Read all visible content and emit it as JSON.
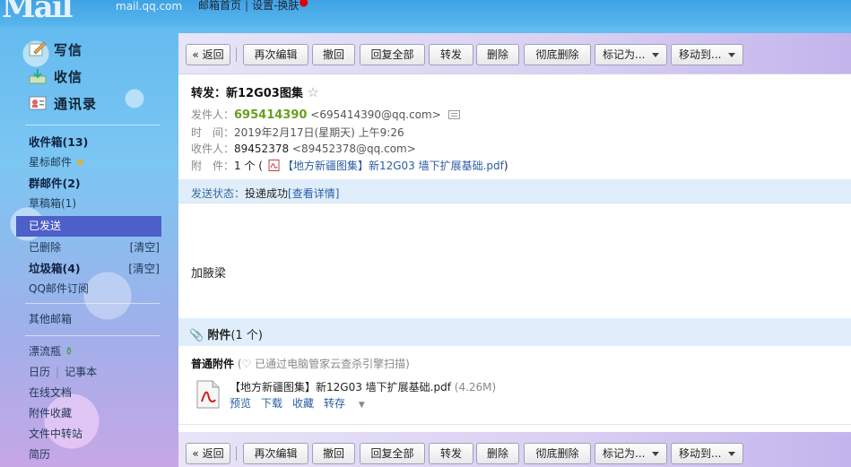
{
  "app": {
    "logo_text": "Mail",
    "logo_domain": "mail.qq.com"
  },
  "topnav": {
    "home": "邮箱首页",
    "sep": "|",
    "settings": "设置",
    "dash": "-",
    "skin": "换肤"
  },
  "sidebar": {
    "actions": [
      {
        "label": "写信",
        "icon": "write-icon"
      },
      {
        "label": "收信",
        "icon": "inbox-download-icon"
      },
      {
        "label": "通讯录",
        "icon": "contacts-icon"
      }
    ],
    "folders": [
      {
        "label": "收件箱(13)",
        "bold": true
      },
      {
        "label": "星标邮件",
        "icon": "star-icon"
      },
      {
        "label": "群邮件(2)",
        "bold": true
      },
      {
        "label": "草稿箱(1)"
      },
      {
        "label": "已发送",
        "active": true
      },
      {
        "label": "已删除",
        "action": "[清空]"
      },
      {
        "label": "垃圾箱(4)",
        "bold": true,
        "action": "[清空]"
      },
      {
        "label": "QQ邮件订阅"
      }
    ],
    "other": "其他邮箱",
    "apps": [
      {
        "label": "漂流瓶",
        "icon": "bottle-icon"
      },
      {
        "label": "日历",
        "extra": "记事本"
      },
      {
        "label": "在线文档"
      },
      {
        "label": "附件收藏"
      },
      {
        "label": "文件中转站"
      },
      {
        "label": "简历"
      }
    ]
  },
  "toolbar": {
    "back": "« 返回",
    "edit_again": "再次编辑",
    "recall": "撤回",
    "reply_all": "回复全部",
    "forward": "转发",
    "delete": "删除",
    "delete_perm": "彻底删除",
    "mark_as": "标记为...",
    "move_to": "移动到..."
  },
  "email": {
    "subject": "转发：新12G03图集",
    "from_label": "发件人：",
    "from_name": "695414390",
    "from_addr": "<695414390@qq.com>",
    "time_label": "时　间：",
    "time": "2019年2月17日(星期天) 上午9:26",
    "to_label": "收件人：",
    "to_name": "89452378",
    "to_addr": "<89452378@qq.com>",
    "att_label": "附　件：",
    "att_count": "1 个 (",
    "att_file": "【地方新疆图集】新12G03 墙下扩展基础.pdf",
    "att_close": ")",
    "status_label": "发送状态：",
    "status_value": "投递成功",
    "status_link": "[查看详情]",
    "body": "加腋梁"
  },
  "attachments": {
    "heading": "附件",
    "count": "(1 个)",
    "type_label": "普通附件",
    "scan_note": "(♡ 已通过电脑管家云查杀引擎扫描)",
    "file_name": "【地方新疆图集】新12G03 墙下扩展基础.pdf",
    "file_size": "(4.26M)",
    "actions": {
      "preview": "预览",
      "download": "下载",
      "collect": "收藏",
      "save_to": "转存"
    }
  },
  "colors": {
    "active_folder": "#4d5fc8",
    "sender": "#6a9e1f",
    "link": "#2b5da5",
    "header_band": "#dfeefa"
  }
}
